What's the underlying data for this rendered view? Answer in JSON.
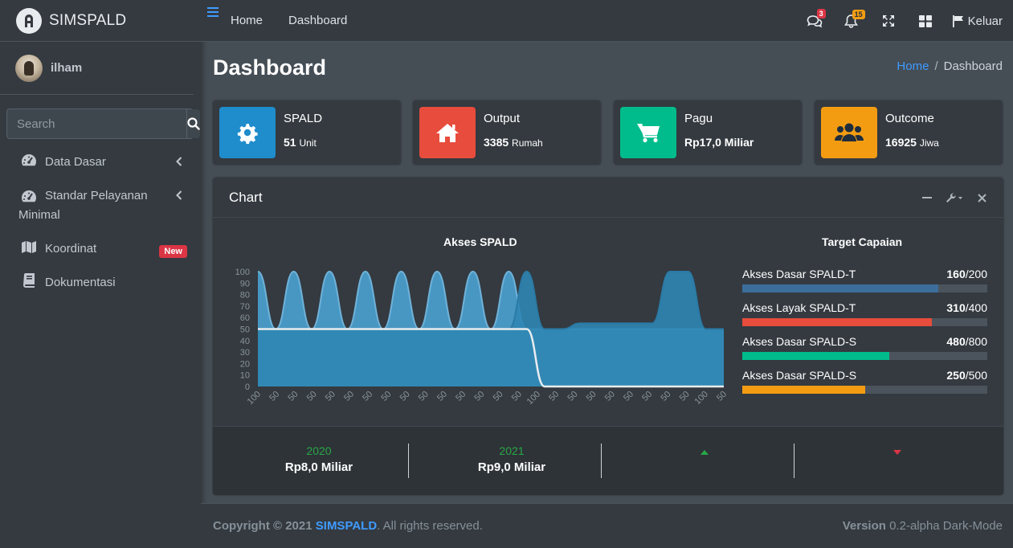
{
  "brand": {
    "name": "SIMSPALD"
  },
  "user": {
    "name": "ilham"
  },
  "search": {
    "placeholder": "Search"
  },
  "sidebar": {
    "items": [
      {
        "label": "Data Dasar"
      },
      {
        "label_line1": "Standar Pelayanan",
        "label_line2": "Minimal"
      },
      {
        "label": "Koordinat",
        "badge": "New"
      },
      {
        "label": "Dokumentasi"
      }
    ]
  },
  "topbar": {
    "links": [
      "Home",
      "Dashboard"
    ],
    "messages_count": "3",
    "notifications_count": "15",
    "logout_label": "Keluar"
  },
  "page": {
    "title": "Dashboard",
    "breadcrumb": {
      "home": "Home",
      "current": "Dashboard"
    }
  },
  "info_boxes": [
    {
      "title": "SPALD",
      "value": "51",
      "unit": "Unit",
      "color": "#17a2b8",
      "icon": "gear-icon"
    },
    {
      "title": "Output",
      "value": "3385",
      "unit": "Rumah",
      "color": "#dc3545",
      "icon": "home-icon"
    },
    {
      "title": "Pagu",
      "value": "Rp17,0 Miliar",
      "unit": "",
      "color": "#00bc8c",
      "icon": "cart-icon"
    },
    {
      "title": "Outcome",
      "value": "16925",
      "unit": "Jiwa",
      "color": "#f39c12",
      "icon": "users-icon"
    }
  ],
  "card": {
    "title": "Chart"
  },
  "chart_data": {
    "type": "area",
    "title": "Akses SPALD",
    "ylim": [
      0,
      100
    ],
    "yticks": [
      0,
      10,
      20,
      30,
      40,
      50,
      60,
      70,
      80,
      90,
      100
    ],
    "x": [
      "100",
      "50",
      "50",
      "50",
      "50",
      "50",
      "50",
      "50",
      "50",
      "50",
      "50",
      "50",
      "50",
      "50",
      "50",
      "100",
      "50",
      "50",
      "50",
      "50",
      "50",
      "50",
      "50",
      "50",
      "100",
      "50"
    ],
    "series": [
      {
        "values": [
          100,
          50,
          100,
          50,
          100,
          50,
          100,
          50,
          100,
          50,
          100,
          50,
          100,
          50,
          100,
          50,
          50,
          50,
          50,
          50,
          50,
          50,
          50,
          50,
          50,
          50,
          50
        ],
        "color": "#4a9cc9"
      },
      {
        "values": [
          50,
          50,
          50,
          50,
          50,
          50,
          50,
          50,
          50,
          50,
          50,
          50,
          50,
          50,
          50,
          100,
          50,
          50,
          55,
          55,
          55,
          55,
          55,
          100,
          100,
          50,
          50
        ],
        "color": "#2f86b3"
      },
      {
        "values": [
          50,
          50,
          50,
          50,
          50,
          50,
          50,
          50,
          50,
          50,
          50,
          50,
          50,
          50,
          50,
          50,
          0,
          0,
          0,
          0,
          0,
          0,
          0,
          0,
          0,
          0,
          0
        ],
        "color": "#e9ecef"
      }
    ],
    "grid": false
  },
  "target": {
    "title": "Target Capaian",
    "items": [
      {
        "label": "Akses Dasar SPALD-T",
        "current": "160",
        "total": "/200",
        "ratio": 0.8,
        "color": "#3c6e9c"
      },
      {
        "label": "Akses Layak SPALD-T",
        "current": "310",
        "total": "/400",
        "ratio": 0.775,
        "color": "#e74c3c"
      },
      {
        "label": "Akses Dasar SPALD-S",
        "current": "480",
        "total": "/800",
        "ratio": 0.6,
        "color": "#00bc8c"
      },
      {
        "label": "Akses Dasar SPALD-S",
        "current": "250",
        "total": "/500",
        "ratio": 0.5,
        "color": "#f39c12"
      }
    ]
  },
  "footer_desc": [
    {
      "year": "2020",
      "value": "Rp8,0 Miliar"
    },
    {
      "year": "2021",
      "value": "Rp9,0 Miliar"
    }
  ],
  "footer": {
    "copyright": "Copyright © 2021",
    "brand": "SIMSPALD",
    "rights": ". All rights reserved.",
    "version_label": "Version",
    "version_value": "0.2-alpha Dark-Mode"
  }
}
